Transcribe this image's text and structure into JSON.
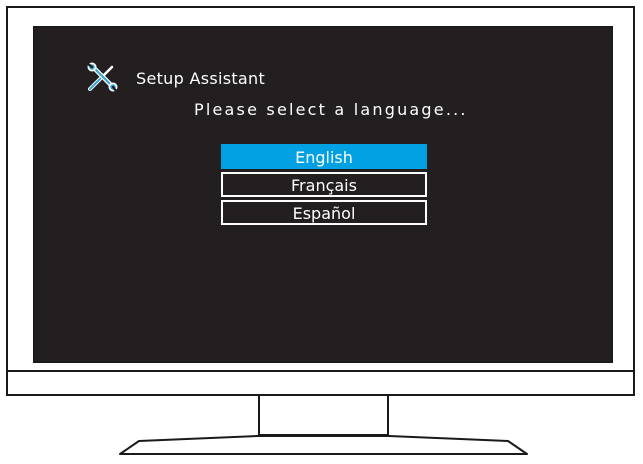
{
  "setup": {
    "title": "Setup Assistant",
    "icon": "tools-icon",
    "prompt": "Please select a language..."
  },
  "languages": [
    {
      "label": "English",
      "selected": true
    },
    {
      "label": "Français",
      "selected": false
    },
    {
      "label": "Español",
      "selected": false
    }
  ],
  "colors": {
    "screen_bg": "#231f20",
    "highlight": "#00a0e3",
    "text": "#ffffff"
  }
}
